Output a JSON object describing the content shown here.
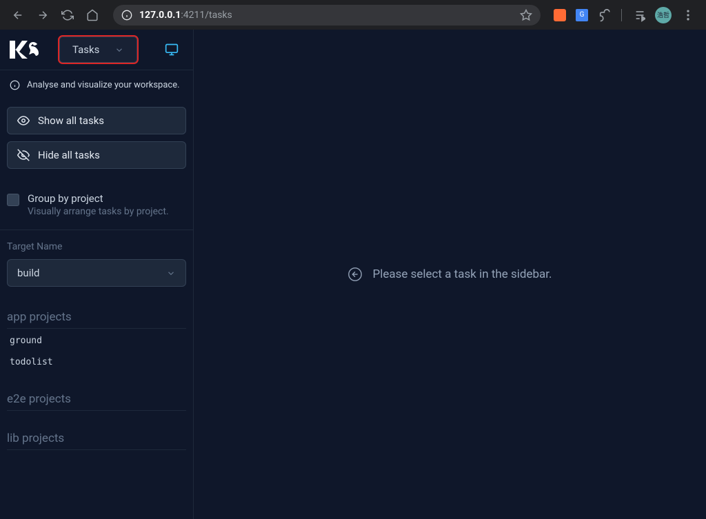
{
  "browser": {
    "url_host": "127.0.0.1",
    "url_path": ":4211/tasks",
    "avatar_text": "浩哲"
  },
  "header": {
    "dropdown_label": "Tasks"
  },
  "info": {
    "text": "Analyse and visualize your workspace."
  },
  "actions": {
    "show_all": "Show all tasks",
    "hide_all": "Hide all tasks"
  },
  "group": {
    "label": "Group by project",
    "sublabel": "Visually arrange tasks by project."
  },
  "target": {
    "label": "Target Name",
    "value": "build"
  },
  "projects": {
    "app_header": "app projects",
    "app_items": [
      "ground",
      "todolist"
    ],
    "e2e_header": "e2e projects",
    "lib_header": "lib projects"
  },
  "main": {
    "empty_text": "Please select a task in the sidebar."
  }
}
